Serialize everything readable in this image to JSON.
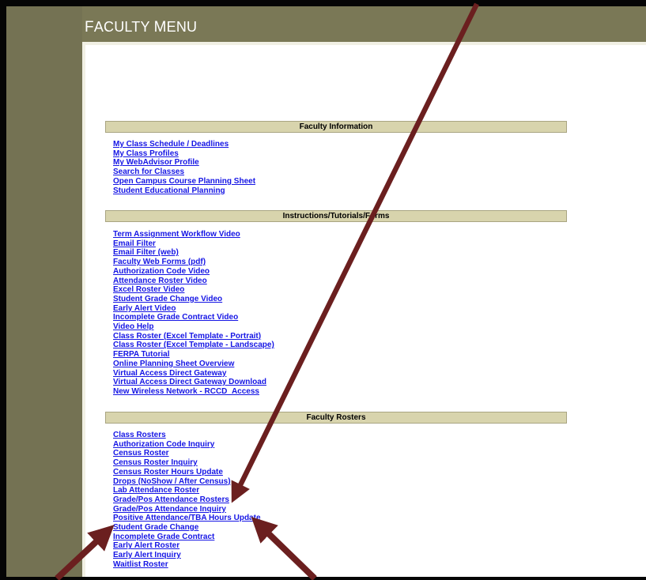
{
  "header": {
    "title_first": "F",
    "title_rest": "ACULTY ",
    "title_second": "M",
    "title_second_rest": "ENU"
  },
  "sections": [
    {
      "title": "Faculty Information",
      "links": [
        "My Class Schedule / Deadlines",
        "My Class Profiles",
        "My WebAdvisor Profile",
        "Search for Classes",
        "Open Campus Course Planning Sheet",
        "Student Educational Planning"
      ]
    },
    {
      "title": "Instructions/Tutorials/Forms",
      "links": [
        "Term Assignment Workflow Video",
        "Email Filter",
        "Email Filter (web)",
        "Faculty Web Forms (pdf)",
        "Authorization Code Video",
        "Attendance Roster Video",
        "Excel Roster Video",
        "Student Grade Change Video",
        "Early Alert Video",
        "Incomplete Grade Contract Video",
        "Video Help",
        "Class Roster (Excel Template - Portrait)",
        "Class Roster (Excel Template - Landscape)",
        "FERPA Tutorial",
        "Online Planning Sheet Overview",
        "Virtual Access Direct Gateway",
        "Virtual Access Direct Gateway Download",
        "New Wireless Network - RCCD_Access"
      ]
    },
    {
      "title": "Faculty Rosters",
      "links": [
        "Class Rosters",
        "Authorization Code Inquiry",
        "Census Roster",
        "Census Roster Inquiry",
        "Census Roster Hours Update",
        "Drops (NoShow / After Census)",
        "Lab Attendance Roster",
        "Grade/Pos Attendance Rosters",
        "Grade/Pos Attendance Inquiry",
        "Positive Attendance/TBA Hours Update",
        "Student Grade Change",
        "Incomplete Grade Contract",
        "Early Alert Roster",
        "Early Alert Inquiry",
        "Waitlist Roster"
      ]
    }
  ],
  "colors": {
    "link": "#1515e5",
    "header_band": "#7a7856",
    "section_header": "#d8d4ad",
    "arrow": "#6b1f1f"
  }
}
